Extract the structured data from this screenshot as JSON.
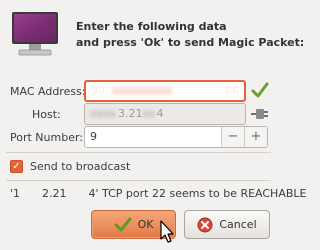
{
  "header": {
    "line1": "Enter the following data",
    "line2": "and press 'Ok' to send Magic Packet:"
  },
  "form": {
    "mac_label": "MAC Address:",
    "mac_prefix": "00:",
    "mac_suffix": "66",
    "host_label": "Host:",
    "host_value": "3.21",
    "host_tail": "4",
    "port_label": "Port Number:",
    "port_value": "9"
  },
  "broadcast": {
    "label": "Send to broadcast",
    "checked": true
  },
  "status": {
    "text": "'1  2.21  4' TCP port 22 seems to be REACHABLE"
  },
  "buttons": {
    "ok_label": "OK",
    "cancel_label": "Cancel"
  },
  "colors": {
    "accent": "#e3623c",
    "check_green": "#6aa12e",
    "cancel_red": "#d9453b"
  }
}
